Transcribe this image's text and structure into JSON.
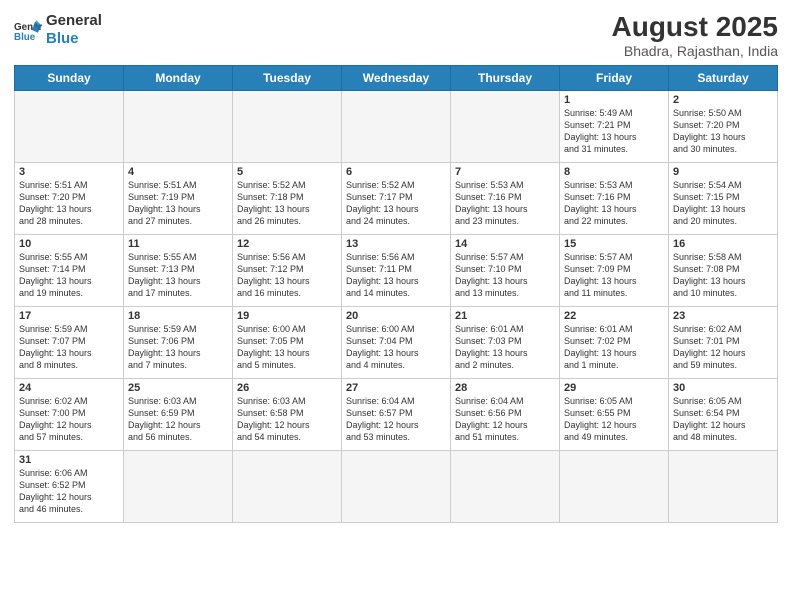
{
  "logo": {
    "general": "General",
    "blue": "Blue"
  },
  "title": "August 2025",
  "subtitle": "Bhadra, Rajasthan, India",
  "days_header": [
    "Sunday",
    "Monday",
    "Tuesday",
    "Wednesday",
    "Thursday",
    "Friday",
    "Saturday"
  ],
  "weeks": [
    [
      {
        "day": "",
        "info": ""
      },
      {
        "day": "",
        "info": ""
      },
      {
        "day": "",
        "info": ""
      },
      {
        "day": "",
        "info": ""
      },
      {
        "day": "",
        "info": ""
      },
      {
        "day": "1",
        "info": "Sunrise: 5:49 AM\nSunset: 7:21 PM\nDaylight: 13 hours\nand 31 minutes."
      },
      {
        "day": "2",
        "info": "Sunrise: 5:50 AM\nSunset: 7:20 PM\nDaylight: 13 hours\nand 30 minutes."
      }
    ],
    [
      {
        "day": "3",
        "info": "Sunrise: 5:51 AM\nSunset: 7:20 PM\nDaylight: 13 hours\nand 28 minutes."
      },
      {
        "day": "4",
        "info": "Sunrise: 5:51 AM\nSunset: 7:19 PM\nDaylight: 13 hours\nand 27 minutes."
      },
      {
        "day": "5",
        "info": "Sunrise: 5:52 AM\nSunset: 7:18 PM\nDaylight: 13 hours\nand 26 minutes."
      },
      {
        "day": "6",
        "info": "Sunrise: 5:52 AM\nSunset: 7:17 PM\nDaylight: 13 hours\nand 24 minutes."
      },
      {
        "day": "7",
        "info": "Sunrise: 5:53 AM\nSunset: 7:16 PM\nDaylight: 13 hours\nand 23 minutes."
      },
      {
        "day": "8",
        "info": "Sunrise: 5:53 AM\nSunset: 7:16 PM\nDaylight: 13 hours\nand 22 minutes."
      },
      {
        "day": "9",
        "info": "Sunrise: 5:54 AM\nSunset: 7:15 PM\nDaylight: 13 hours\nand 20 minutes."
      }
    ],
    [
      {
        "day": "10",
        "info": "Sunrise: 5:55 AM\nSunset: 7:14 PM\nDaylight: 13 hours\nand 19 minutes."
      },
      {
        "day": "11",
        "info": "Sunrise: 5:55 AM\nSunset: 7:13 PM\nDaylight: 13 hours\nand 17 minutes."
      },
      {
        "day": "12",
        "info": "Sunrise: 5:56 AM\nSunset: 7:12 PM\nDaylight: 13 hours\nand 16 minutes."
      },
      {
        "day": "13",
        "info": "Sunrise: 5:56 AM\nSunset: 7:11 PM\nDaylight: 13 hours\nand 14 minutes."
      },
      {
        "day": "14",
        "info": "Sunrise: 5:57 AM\nSunset: 7:10 PM\nDaylight: 13 hours\nand 13 minutes."
      },
      {
        "day": "15",
        "info": "Sunrise: 5:57 AM\nSunset: 7:09 PM\nDaylight: 13 hours\nand 11 minutes."
      },
      {
        "day": "16",
        "info": "Sunrise: 5:58 AM\nSunset: 7:08 PM\nDaylight: 13 hours\nand 10 minutes."
      }
    ],
    [
      {
        "day": "17",
        "info": "Sunrise: 5:59 AM\nSunset: 7:07 PM\nDaylight: 13 hours\nand 8 minutes."
      },
      {
        "day": "18",
        "info": "Sunrise: 5:59 AM\nSunset: 7:06 PM\nDaylight: 13 hours\nand 7 minutes."
      },
      {
        "day": "19",
        "info": "Sunrise: 6:00 AM\nSunset: 7:05 PM\nDaylight: 13 hours\nand 5 minutes."
      },
      {
        "day": "20",
        "info": "Sunrise: 6:00 AM\nSunset: 7:04 PM\nDaylight: 13 hours\nand 4 minutes."
      },
      {
        "day": "21",
        "info": "Sunrise: 6:01 AM\nSunset: 7:03 PM\nDaylight: 13 hours\nand 2 minutes."
      },
      {
        "day": "22",
        "info": "Sunrise: 6:01 AM\nSunset: 7:02 PM\nDaylight: 13 hours\nand 1 minute."
      },
      {
        "day": "23",
        "info": "Sunrise: 6:02 AM\nSunset: 7:01 PM\nDaylight: 12 hours\nand 59 minutes."
      }
    ],
    [
      {
        "day": "24",
        "info": "Sunrise: 6:02 AM\nSunset: 7:00 PM\nDaylight: 12 hours\nand 57 minutes."
      },
      {
        "day": "25",
        "info": "Sunrise: 6:03 AM\nSunset: 6:59 PM\nDaylight: 12 hours\nand 56 minutes."
      },
      {
        "day": "26",
        "info": "Sunrise: 6:03 AM\nSunset: 6:58 PM\nDaylight: 12 hours\nand 54 minutes."
      },
      {
        "day": "27",
        "info": "Sunrise: 6:04 AM\nSunset: 6:57 PM\nDaylight: 12 hours\nand 53 minutes."
      },
      {
        "day": "28",
        "info": "Sunrise: 6:04 AM\nSunset: 6:56 PM\nDaylight: 12 hours\nand 51 minutes."
      },
      {
        "day": "29",
        "info": "Sunrise: 6:05 AM\nSunset: 6:55 PM\nDaylight: 12 hours\nand 49 minutes."
      },
      {
        "day": "30",
        "info": "Sunrise: 6:05 AM\nSunset: 6:54 PM\nDaylight: 12 hours\nand 48 minutes."
      }
    ],
    [
      {
        "day": "31",
        "info": "Sunrise: 6:06 AM\nSunset: 6:52 PM\nDaylight: 12 hours\nand 46 minutes."
      },
      {
        "day": "",
        "info": ""
      },
      {
        "day": "",
        "info": ""
      },
      {
        "day": "",
        "info": ""
      },
      {
        "day": "",
        "info": ""
      },
      {
        "day": "",
        "info": ""
      },
      {
        "day": "",
        "info": ""
      }
    ]
  ]
}
